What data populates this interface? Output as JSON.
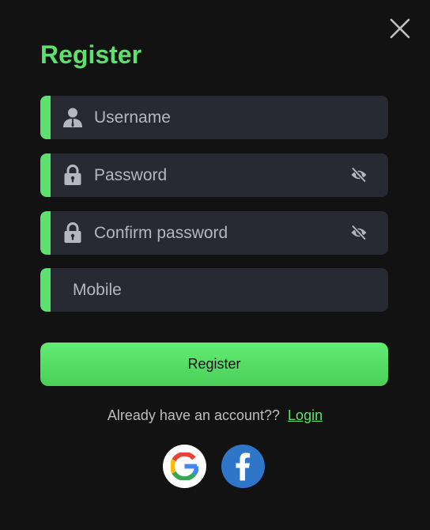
{
  "title": "Register",
  "close_icon": "close-icon",
  "fields": {
    "username": {
      "placeholder": "Username",
      "icon": "user-icon"
    },
    "password": {
      "placeholder": "Password",
      "icon": "lock-icon",
      "toggle_icon": "eye-off-icon"
    },
    "confirm_password": {
      "placeholder": "Confirm password",
      "icon": "lock-icon",
      "toggle_icon": "eye-off-icon"
    },
    "mobile": {
      "placeholder": "Mobile"
    }
  },
  "register_button": "Register",
  "account_prompt": "Already have an account??",
  "login_link": "Login",
  "social": {
    "google_icon": "google-icon",
    "facebook_icon": "facebook-icon"
  },
  "colors": {
    "background": "#121212",
    "accent": "#5ee06e",
    "field_background": "#272a33",
    "facebook": "#2f76c9"
  }
}
